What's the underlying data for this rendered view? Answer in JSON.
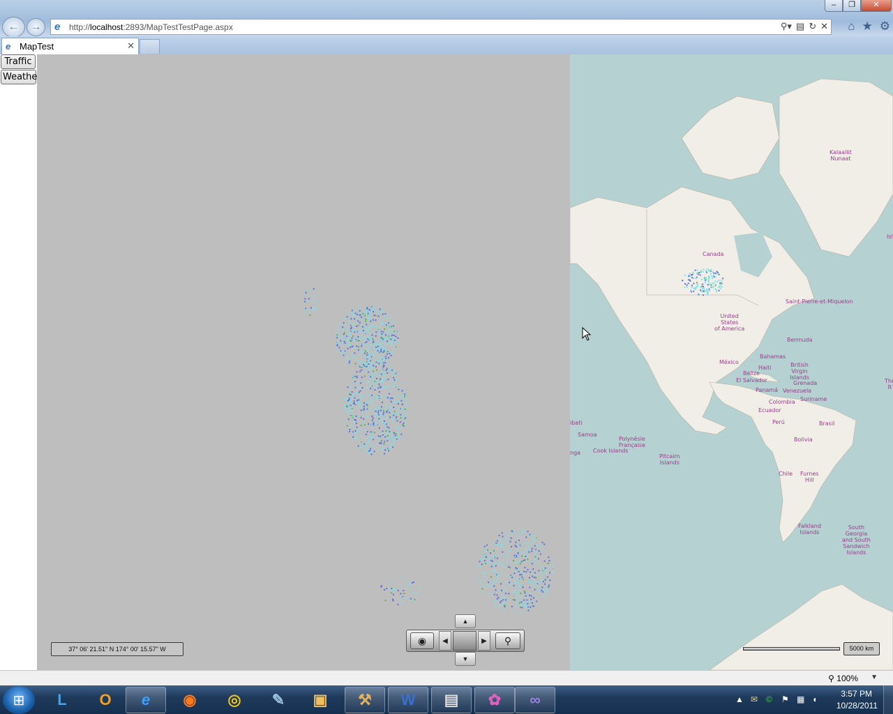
{
  "browser": {
    "url_prefix": "http://",
    "url_host": "localhost",
    "url_rest": ":2893/MapTestTestPage.aspx",
    "tab_title": "MapTest",
    "icons": {
      "back": "back-arrow-icon",
      "forward": "forward-arrow-icon",
      "search": "search-icon",
      "compat": "compatibility-view-icon",
      "refresh": "refresh-icon",
      "stop": "stop-icon",
      "home": "home-icon",
      "favorites": "star-icon",
      "tools": "gear-icon"
    }
  },
  "page": {
    "traffic_button": "Traffic",
    "weather_button": "Weather"
  },
  "map": {
    "coordinates": "37° 06' 21.51\" N 174° 00' 15.57\" W",
    "scale": "5000 km",
    "labels": {
      "kalaallit": "Kalaallit\nNunaat",
      "canada": "Canada",
      "usa": "United\nStates\nof America",
      "stpierre": "Saint-Pierre-et-Miquelon",
      "bermuda": "Bermuda",
      "bahamas": "Bahamas",
      "haiti": "Haiti",
      "bvi": "British\nVirgin\nIslands",
      "mexico": "México",
      "belize": "Belize",
      "elsalvador": "El Salvador",
      "grenada": "Grenada",
      "venezuela": "Venezuela",
      "panama": "Panamá",
      "colombia": "Colombia",
      "suriname": "Suriname",
      "ecuador": "Ecuador",
      "brasil": "Brasil",
      "peru": "Perú",
      "bolivia": "Bolivia",
      "chile": "Chile",
      "furnes": "Furnes\nHill",
      "falkland": "Falkland\nIslands",
      "southgeorgia": "South\nGeorgia\nand South\nSandwich\nIslands",
      "samoa": "Samoa",
      "polynesie": "Polynésie\nFrançaise",
      "cook": "Cook Islands",
      "pitcairn": "Pitcairn\nIslands",
      "kiribati": "ibati",
      "tonga": "nga",
      "islands_right": "Isla",
      "the_r": "The R"
    },
    "colors": {
      "ocean": "#b5d1d2",
      "land": "#f1eee8",
      "empty_tile": "#bebebe",
      "label": "#9b3d8a",
      "radar_cyan": "#7ce0e8",
      "radar_blue": "#5a6fe0",
      "radar_green": "#5ab04a"
    }
  },
  "statusbar": {
    "zoom": "100%"
  },
  "taskbar": {
    "apps": [
      "lync-icon",
      "outlook-icon",
      "internet-explorer-icon",
      "firefox-icon",
      "chrome-icon",
      "notepad-icon",
      "explorer-icon",
      "tools-icon",
      "word-icon",
      "document-icon",
      "paint-icon",
      "visual-studio-icon"
    ],
    "time": "3:57 PM",
    "date": "10/28/2011"
  }
}
